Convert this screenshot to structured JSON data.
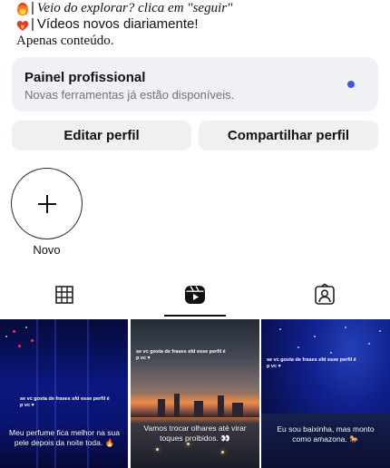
{
  "bio": {
    "line1_bar": "|",
    "line1_text": "Veio do explorar? clica em \"seguir\"",
    "line2_bar": "|",
    "line2_text": "Vídeos novos diariamente!",
    "line3_text": "Apenas conteúdo.",
    "line1_icon": "fire-emoji",
    "line2_icon": "fire-heart-emoji"
  },
  "painel": {
    "title": "Painel profissional",
    "subtitle": "Novas ferramentas já estão disponíveis.",
    "dot_color": "#3b5bdb"
  },
  "buttons": {
    "edit": "Editar perfil",
    "share": "Compartilhar perfil"
  },
  "highlight": {
    "new_label": "Novo",
    "icon": "plus-icon"
  },
  "tabs": [
    {
      "icon": "grid-icon",
      "active": false
    },
    {
      "icon": "reels-icon",
      "active": true
    },
    {
      "icon": "tagged-person-icon",
      "active": false
    }
  ],
  "thumbnails": [
    {
      "small_caption": "se vc gosta de frases sfd esse perfil é p vc ♥",
      "caption": "Meu perfume fica melhor na sua pele depois da noite toda. 🔥"
    },
    {
      "small_caption": "se vc gosta de frases sfd esse perfil é p vc ♥",
      "caption": "Vamos trocar olhares até virar toques proibidos. 👀"
    },
    {
      "small_caption": "se vc gosta de frases sfd esse perfil é p vc ♥",
      "caption": "Eu sou baixinha, mas monto como amazona. 🐎"
    }
  ]
}
